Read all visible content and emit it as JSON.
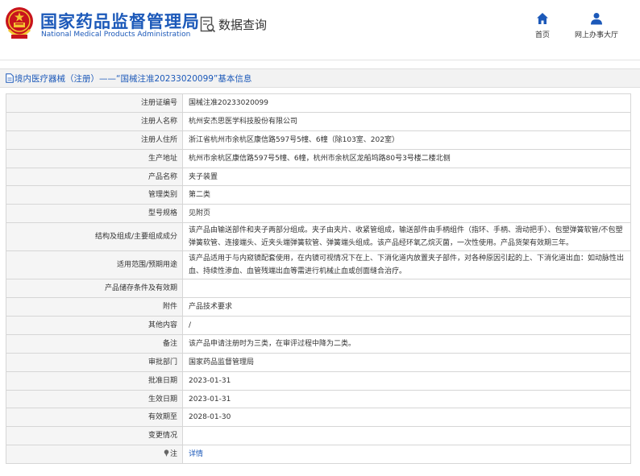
{
  "header": {
    "site_name": "国家药品监督管理局",
    "site_name_en": "National Medical Products Administration",
    "query_title": "数据查询",
    "nav": [
      {
        "label": "首页",
        "icon": "home-icon"
      },
      {
        "label": "网上办事大厅",
        "icon": "user-icon"
      }
    ]
  },
  "colors": {
    "brand": "#1c59b9",
    "label_bg": "#f5f5f5",
    "border": "#d6d6d6"
  },
  "breadcrumb": {
    "text": "境内医疗器械（注册）——“国械注准20233020099”基本信息"
  },
  "rows": [
    {
      "label": "注册证编号",
      "value": "国械注准20233020099"
    },
    {
      "label": "注册人名称",
      "value": "杭州安杰思医学科技股份有限公司"
    },
    {
      "label": "注册人住所",
      "value": "浙江省杭州市余杭区康信路597号5幢、6幢（除103室、202室）"
    },
    {
      "label": "生产地址",
      "value": "杭州市余杭区康信路597号5幢、6幢，杭州市余杭区龙船坞路80号3号楼二楼北侧"
    },
    {
      "label": "产品名称",
      "value": "夹子装置"
    },
    {
      "label": "管理类别",
      "value": "第二类"
    },
    {
      "label": "型号规格",
      "value": "见附页"
    },
    {
      "label": "结构及组成/主要组成成分",
      "value": "该产品由输送部件和夹子两部分组成。夹子由夹片、收紧管组成，输送部件由手柄组件（指环、手柄、滑动把手）、包塑弹簧软管/不包塑弹簧软管、连接端头、近夹头端弹簧软管、弹簧端头组成。该产品经环氧乙烷灭菌，一次性使用。产品货架有效期三年。"
    },
    {
      "label": "适用范围/预期用途",
      "value": "该产品适用于与内窥镜配套使用，在内镜可视情况下在上、下消化道内放置夹子部件，对各种原因引起的上、下消化道出血：如动脉性出血、持续性渗血、血管残端出血等需进行机械止血或创面缝合治疗。"
    },
    {
      "label": "产品储存条件及有效期",
      "value": ""
    },
    {
      "label": "附件",
      "value": "产品技术要求"
    },
    {
      "label": "其他内容",
      "value": "/"
    },
    {
      "label": "备注",
      "value": "该产品申请注册时为三类，在审评过程中降为二类。"
    },
    {
      "label": "审批部门",
      "value": "国家药品监督管理局"
    },
    {
      "label": "批准日期",
      "value": "2023-01-31"
    },
    {
      "label": "生效日期",
      "value": "2023-01-31"
    },
    {
      "label": "有效期至",
      "value": "2028-01-30"
    },
    {
      "label": "变更情况",
      "value": ""
    },
    {
      "label": "注",
      "value": "详情",
      "icon": "pin-icon"
    }
  ]
}
